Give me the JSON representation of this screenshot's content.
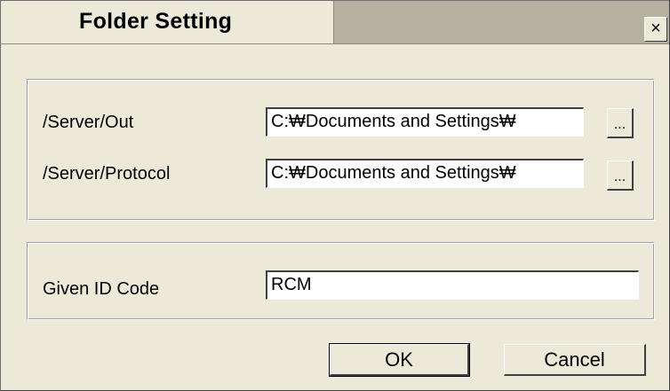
{
  "dialog": {
    "title": "Folder Setting",
    "close_label": "×"
  },
  "paths": {
    "server_out": {
      "label": "/Server/Out",
      "value": "C:₩Documents and Settings₩",
      "browse_label": "..."
    },
    "server_protocol": {
      "label": "/Server/Protocol",
      "value": "C:₩Documents and Settings₩",
      "browse_label": "..."
    }
  },
  "id_code": {
    "label": "Given ID Code",
    "value": "RCM"
  },
  "buttons": {
    "ok_label": "OK",
    "cancel_label": "Cancel"
  }
}
